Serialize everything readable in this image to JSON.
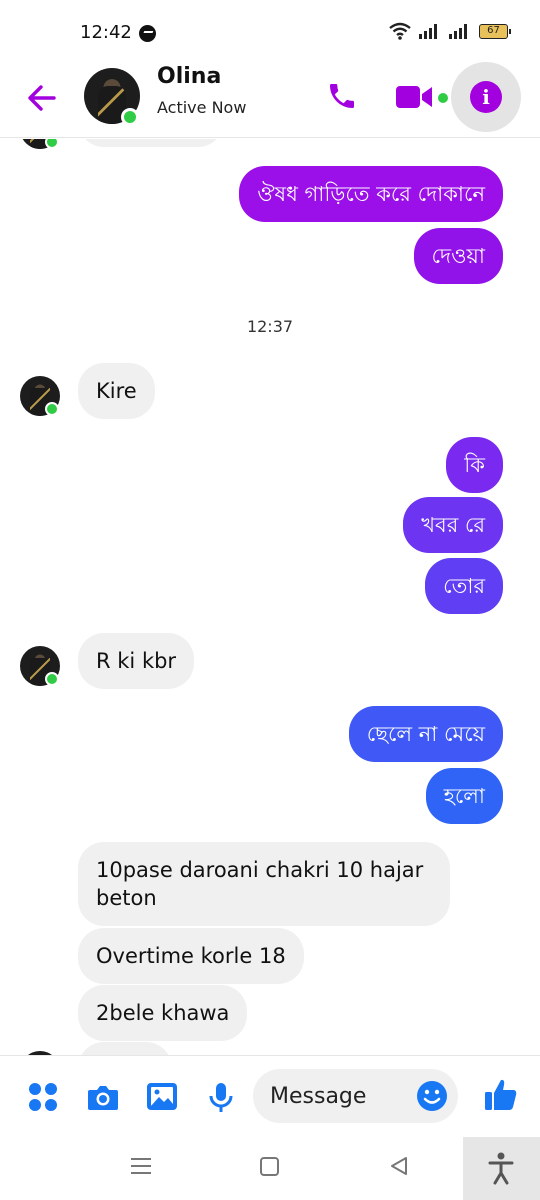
{
  "status_bar": {
    "time": "12:42",
    "battery": "67"
  },
  "header": {
    "contact_name": "Olina",
    "contact_status": "Active Now"
  },
  "colors": {
    "accent": "#a300e0",
    "online": "#31cc46",
    "incoming_bg": "#f0f0f0",
    "blue": "#1877f2"
  },
  "messages": {
    "out1a": "ঔষধ গাড়িতে করে দোকানে",
    "out1b": "দেওয়া",
    "time": "12:37",
    "in1": "Kire",
    "out2a": "কি",
    "out2b": "খবর রে",
    "out2c": "তোর",
    "in2": "R ki kbr",
    "out3a": "ছেলে না মেয়ে",
    "out3b": "হলো",
    "in3a_line1": "10pase daroani chakri 10 hajar",
    "in3a_line2": "beton",
    "in3b": "Overtime korle 18",
    "in3c": "2bele khawa"
  },
  "composer": {
    "placeholder": "Message"
  }
}
